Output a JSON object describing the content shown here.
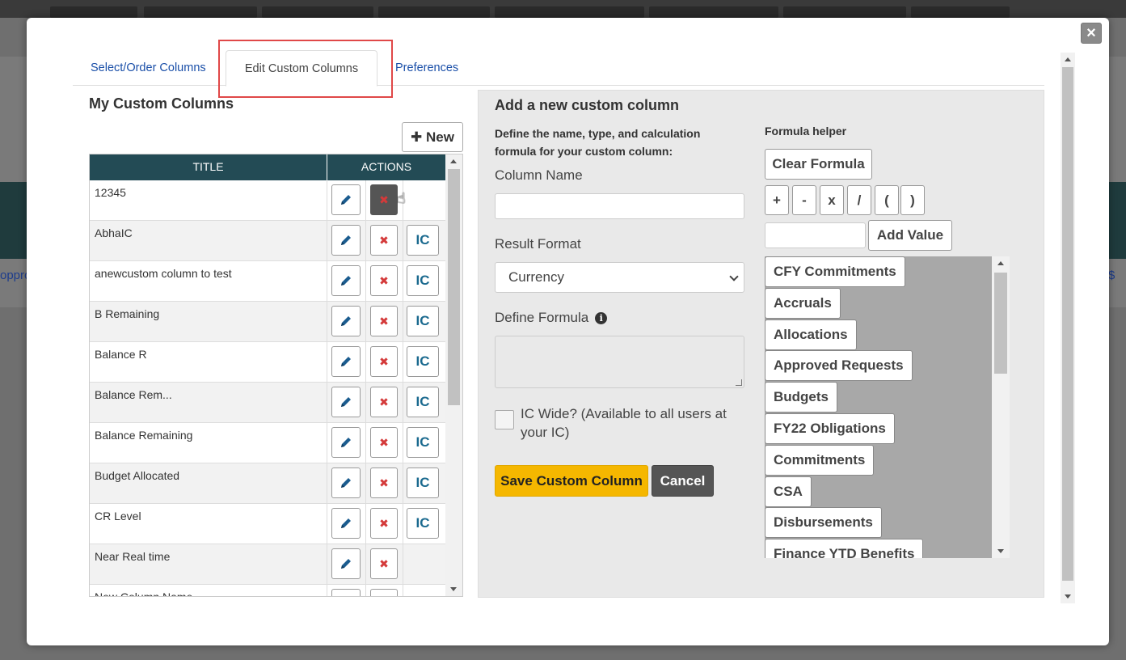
{
  "background": {
    "left_link_fragment": "opprop",
    "right_link_fragment": "$"
  },
  "tabs": {
    "select_order": "Select/Order Columns",
    "edit_custom": "Edit Custom Columns",
    "preferences": "Preferences"
  },
  "close_label": "×",
  "left": {
    "title": "My Custom Columns",
    "new_label": "New",
    "columns": [
      "TITLE",
      "ACTIONS"
    ],
    "rows": [
      {
        "title": "12345",
        "ic": false
      },
      {
        "title": "AbhaIC",
        "ic": true
      },
      {
        "title": "anewcustom column to test",
        "ic": true
      },
      {
        "title": "B Remaining",
        "ic": true
      },
      {
        "title": "Balance R",
        "ic": true
      },
      {
        "title": "Balance Rem...",
        "ic": true
      },
      {
        "title": "Balance Remaining",
        "ic": true
      },
      {
        "title": "Budget Allocated",
        "ic": true
      },
      {
        "title": "CR Level",
        "ic": true
      },
      {
        "title": "Near Real time",
        "ic": false
      },
      {
        "title": "New Column Name",
        "ic": false
      }
    ],
    "ic_label": "IC",
    "delete_glyph": "✖"
  },
  "right": {
    "title": "Add a new custom column",
    "description": "Define the name, type, and calculation formula for your custom column:",
    "column_name_label": "Column Name",
    "column_name_value": "",
    "result_format_label": "Result Format",
    "result_format_value": "Currency",
    "define_formula_label": "Define Formula",
    "formula_value": "",
    "ic_wide_label": "IC Wide? (Available to all users at your IC)",
    "save_label": "Save Custom Column",
    "cancel_label": "Cancel",
    "helper": {
      "title": "Formula helper",
      "clear_label": "Clear Formula",
      "operators": [
        "+",
        "-",
        "x",
        "/",
        "(",
        ")"
      ],
      "value_input": "",
      "add_value_label": "Add Value",
      "fields": [
        "CFY Commitments",
        "Accruals",
        "Allocations",
        "Approved Requests",
        "Budgets",
        "FY22 Obligations",
        "Commitments",
        "CSA",
        "Disbursements",
        "Finance YTD Benefits"
      ]
    }
  }
}
